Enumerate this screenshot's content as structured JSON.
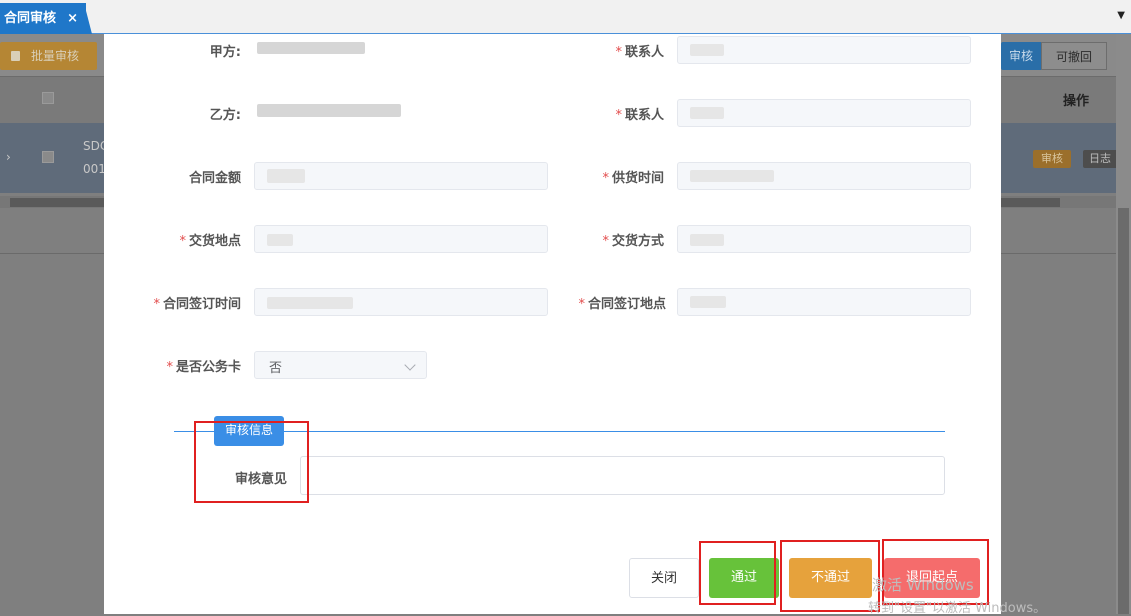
{
  "tab": {
    "title": "合同审核",
    "close_glyph": "×"
  },
  "toolbar": {
    "batch_audit": "批量审核"
  },
  "segments": {
    "audit": "审核",
    "revocable": "可撤回"
  },
  "table": {
    "op_header": "操作",
    "row_code_line1": "SDC",
    "row_code_line2": "001",
    "tag_audit": "审核",
    "tag_log": "日志"
  },
  "form": {
    "party_a": "甲方:",
    "party_b": "乙方:",
    "contact_1": "联系人",
    "contact_2": "联系人",
    "amount": "合同金额",
    "supply_time": "供货时间",
    "delivery_place": "交货地点",
    "delivery_method": "交货方式",
    "sign_time": "合同签订时间",
    "sign_place": "合同签订地点",
    "official_card": "是否公务卡",
    "official_card_value": "否",
    "required_mark": "*"
  },
  "audit": {
    "section_title": "审核信息",
    "opinion_label": "审核意见",
    "opinion_value": ""
  },
  "actions": {
    "close": "关闭",
    "pass": "通过",
    "reject": "不通过",
    "return_start": "退回起点"
  },
  "watermark": {
    "line1": "激活 Windows",
    "line2": "转到\"设置\"以激活 Windows。"
  },
  "colors": {
    "primary": "#3a8ee6",
    "tab": "#1f77c9",
    "pass": "#67c23a",
    "reject": "#e6a23c",
    "return": "#f56c6c",
    "annotation": "#e02020"
  }
}
